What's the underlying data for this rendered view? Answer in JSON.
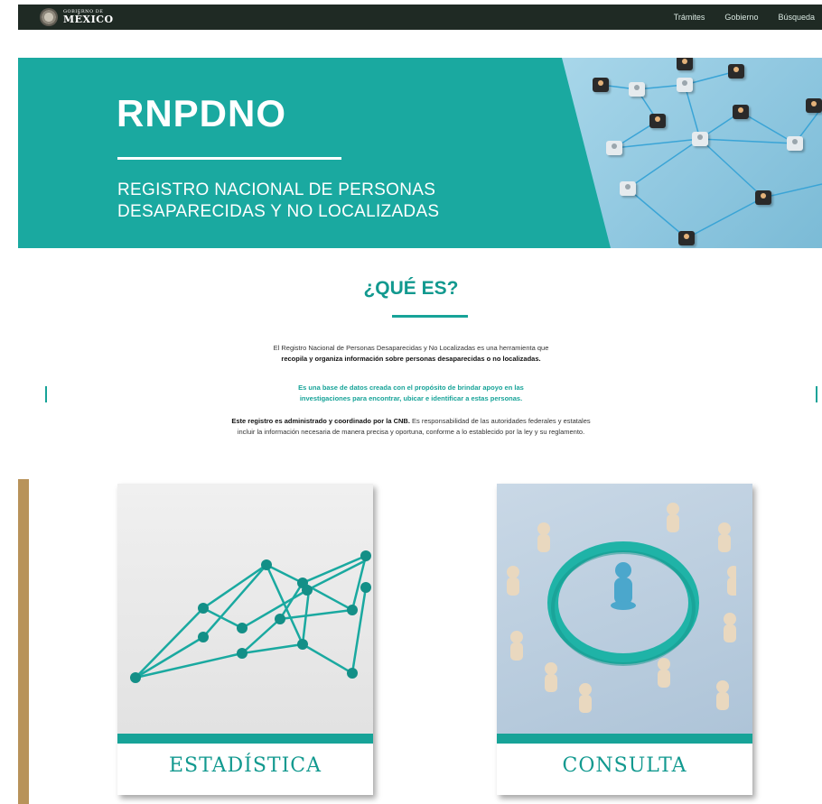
{
  "header": {
    "logo": {
      "top": "GOBIERNO DE",
      "main": "MÉXICO"
    },
    "nav": [
      "Trámites",
      "Gobierno",
      "Búsqueda"
    ]
  },
  "hero": {
    "title": "RNPDNO",
    "subtitle_line1": "REGISTRO NACIONAL DE PERSONAS",
    "subtitle_line2": "DESAPARECIDAS Y NO LOCALIZADAS"
  },
  "section": {
    "title": "¿QUÉ ES?",
    "p1_line1": "El Registro Nacional de Personas Desaparecidas y No Localizadas es una herramienta que",
    "p1_line2": "recopila y organiza información sobre personas desaparecidas o no localizadas.",
    "p2_line1": "Es una base de datos creada con el propósito de brindar apoyo en las",
    "p2_line2": "investigaciones para encontrar, ubicar e identificar a estas personas.",
    "p3_bold": "Este registro es administrado y coordinado por la CNB.",
    "p3_rest": " Es responsabilidad de las autoridades federales y estatales",
    "p3_line2": "incluir la información necesaria de manera precisa y oportuna, conforme a lo establecido por la ley y su reglamento."
  },
  "cards": [
    {
      "label": "ESTADÍSTICA",
      "icon": "string-graph-icon"
    },
    {
      "label": "CONSULTA",
      "icon": "pawns-ring-icon"
    }
  ],
  "colors": {
    "teal": "#1aa9a0",
    "dark_bar": "#1f2a24",
    "gold": "#b8935a"
  }
}
